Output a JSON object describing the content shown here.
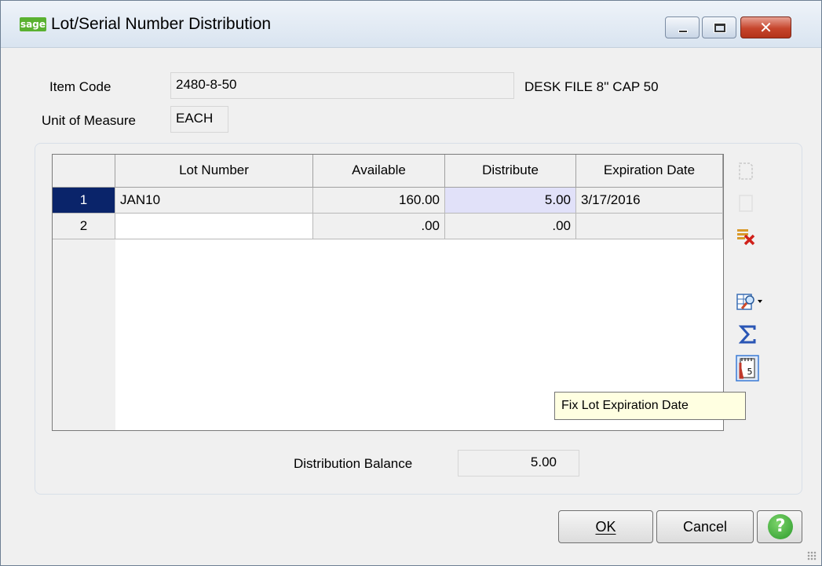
{
  "window": {
    "app_icon": "sage",
    "title": "Lot/Serial Number Distribution",
    "minimize_icon": "minimize-icon",
    "maximize_icon": "maximize-icon",
    "close_icon": "close-icon"
  },
  "header": {
    "item_code_label": "Item Code",
    "item_code_value": "2480-8-50",
    "item_description": "DESK FILE 8'' CAP 50",
    "uom_label": "Unit of Measure",
    "uom_value": "EACH"
  },
  "grid": {
    "columns": [
      "Lot Number",
      "Available",
      "Distribute",
      "Expiration Date"
    ],
    "rows": [
      {
        "num": "1",
        "lot": "JAN10",
        "available": "160.00",
        "distribute": "5.00",
        "expiration": "3/17/2016"
      },
      {
        "num": "2",
        "lot": "",
        "available": ".00",
        "distribute": ".00",
        "expiration": ""
      }
    ]
  },
  "side_toolbar": {
    "icons": [
      "insert-row-icon",
      "blank-row-icon",
      "delete-row-icon",
      "customize-grid-icon",
      "sum-icon",
      "calendar-fix-icon"
    ],
    "tooltip": "Fix Lot Expiration Date"
  },
  "footer": {
    "balance_label": "Distribution Balance",
    "balance_value": "5.00",
    "ok_label": "OK",
    "cancel_label": "Cancel",
    "help_icon": "help-icon"
  },
  "colors": {
    "selected_row": "#0a246a",
    "edit_cell": "#e1e1f9",
    "tooltip_bg": "#ffffe1",
    "close_button": "#c6452c",
    "help_green": "#2b9b2c"
  }
}
